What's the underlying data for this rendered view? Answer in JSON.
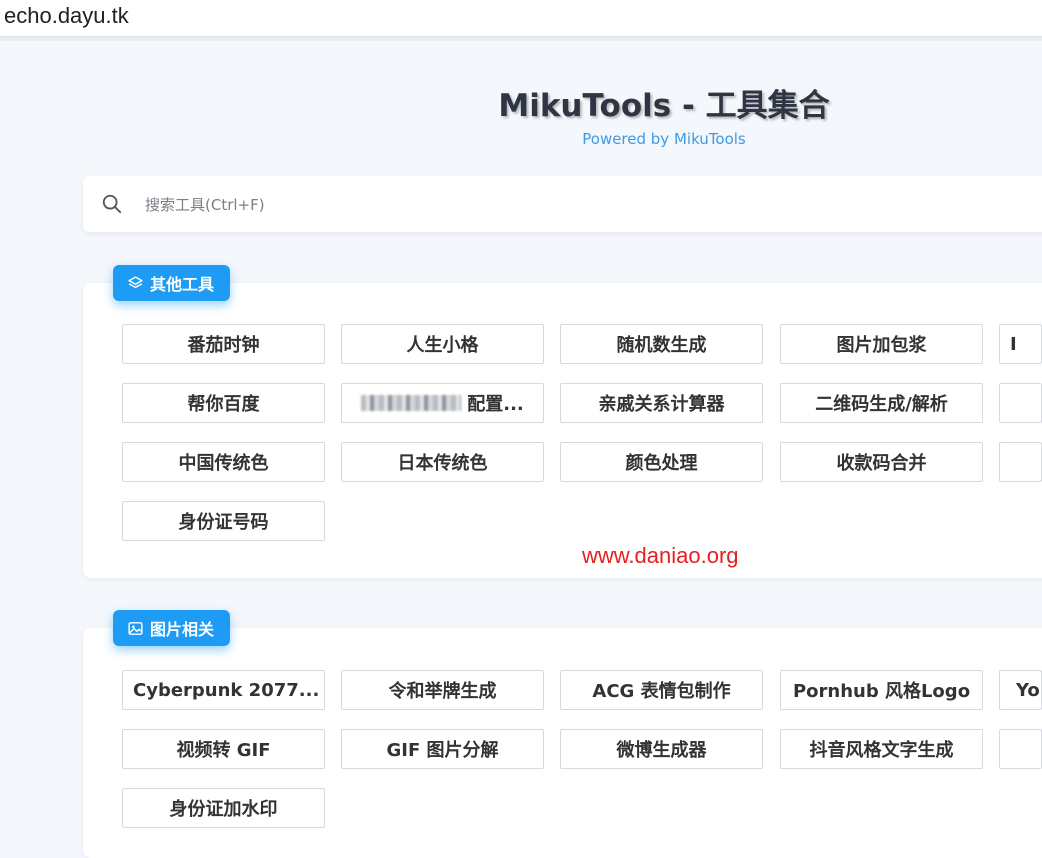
{
  "browser": {
    "url": "echo.dayu.tk"
  },
  "header": {
    "title": "MikuTools - 工具集合",
    "powered": "Powered by MikuTools"
  },
  "search": {
    "placeholder": "搜索工具(Ctrl+F)"
  },
  "sections": [
    {
      "name": "其他工具",
      "icon": "layers-icon",
      "rows": [
        [
          "番茄时钟",
          "人生小格",
          "随机数生成",
          "图片加包浆",
          "I"
        ],
        [
          "帮你百度",
          "配置...",
          "亲戚关系计算器",
          "二维码生成/解析",
          ""
        ],
        [
          "中国传统色",
          "日本传统色",
          "颜色处理",
          "收款码合并",
          ""
        ],
        [
          "身份证号码"
        ]
      ]
    },
    {
      "name": "图片相关",
      "icon": "image-icon",
      "rows": [
        [
          "Cyberpunk 2077...",
          "令和举牌生成",
          "ACG 表情包制作",
          "Pornhub 风格Logo",
          "You"
        ],
        [
          "视频转 GIF",
          "GIF 图片分解",
          "微博生成器",
          "抖音风格文字生成",
          ""
        ],
        [
          "身份证加水印"
        ]
      ]
    }
  ],
  "watermark": "www.daniao.org",
  "colors": {
    "accent": "#1e9bf5",
    "powered": "#3a9be8",
    "watermark": "#e62020"
  }
}
